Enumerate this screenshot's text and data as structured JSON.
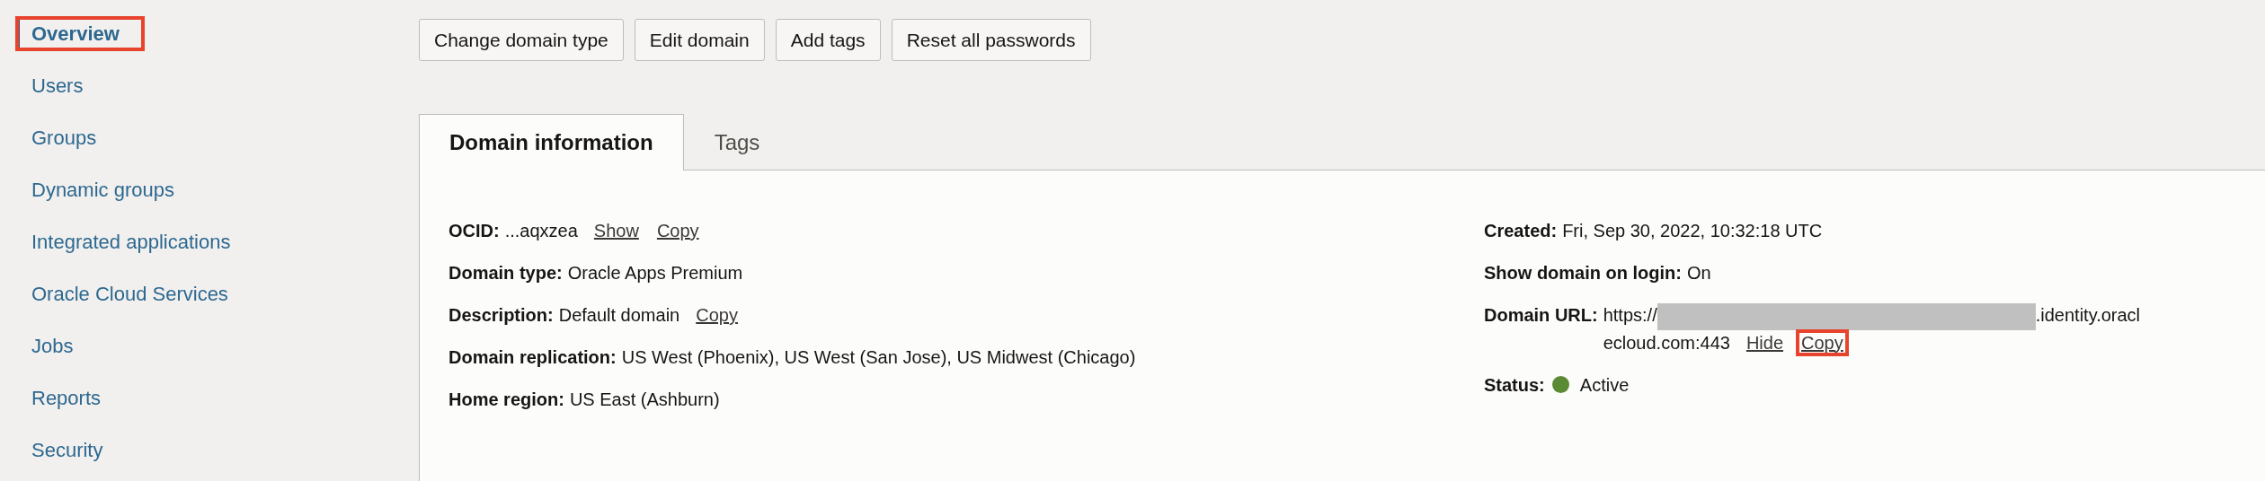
{
  "sidebar": {
    "items": [
      {
        "label": "Overview",
        "selected": true,
        "highlighted": true
      },
      {
        "label": "Users",
        "selected": false,
        "highlighted": false
      },
      {
        "label": "Groups",
        "selected": false,
        "highlighted": false
      },
      {
        "label": "Dynamic groups",
        "selected": false,
        "highlighted": false
      },
      {
        "label": "Integrated applications",
        "selected": false,
        "highlighted": false
      },
      {
        "label": "Oracle Cloud Services",
        "selected": false,
        "highlighted": false
      },
      {
        "label": "Jobs",
        "selected": false,
        "highlighted": false
      },
      {
        "label": "Reports",
        "selected": false,
        "highlighted": false
      },
      {
        "label": "Security",
        "selected": false,
        "highlighted": false
      }
    ]
  },
  "actions": [
    "Change domain type",
    "Edit domain",
    "Add tags",
    "Reset all passwords"
  ],
  "tabs": [
    {
      "label": "Domain information",
      "selected": true
    },
    {
      "label": "Tags",
      "selected": false
    }
  ],
  "left_fields": [
    {
      "kind": "text",
      "label": "OCID:",
      "value": "...aqxzea",
      "links": [
        {
          "label": "Show",
          "highlighted": false
        },
        {
          "label": "Copy",
          "highlighted": false
        }
      ]
    },
    {
      "kind": "text",
      "label": "Domain type:",
      "value": "Oracle Apps Premium"
    },
    {
      "kind": "text",
      "label": "Description:",
      "value": "Default domain",
      "links": [
        {
          "label": "Copy",
          "highlighted": false
        }
      ]
    },
    {
      "kind": "text",
      "label": "Domain replication:",
      "value": "US West (Phoenix), US West (San Jose), US Midwest (Chicago)"
    },
    {
      "kind": "text",
      "label": "Home region:",
      "value": "US East (Ashburn)"
    }
  ],
  "right_fields": [
    {
      "kind": "text",
      "label": "Created:",
      "value": "Fri, Sep 30, 2022, 10:32:18 UTC"
    },
    {
      "kind": "text",
      "label": "Show domain on login:",
      "value": "On"
    },
    {
      "kind": "url",
      "label": "Domain URL:",
      "value": "https://",
      "value_end": ".identity.oracl",
      "value_line2": "ecloud.com:443",
      "links": [
        {
          "label": "Hide",
          "highlighted": false
        },
        {
          "label": "Copy",
          "highlighted": true
        }
      ]
    },
    {
      "kind": "status",
      "label": "Status:",
      "value": "Active",
      "color": "#5b8a35"
    }
  ]
}
